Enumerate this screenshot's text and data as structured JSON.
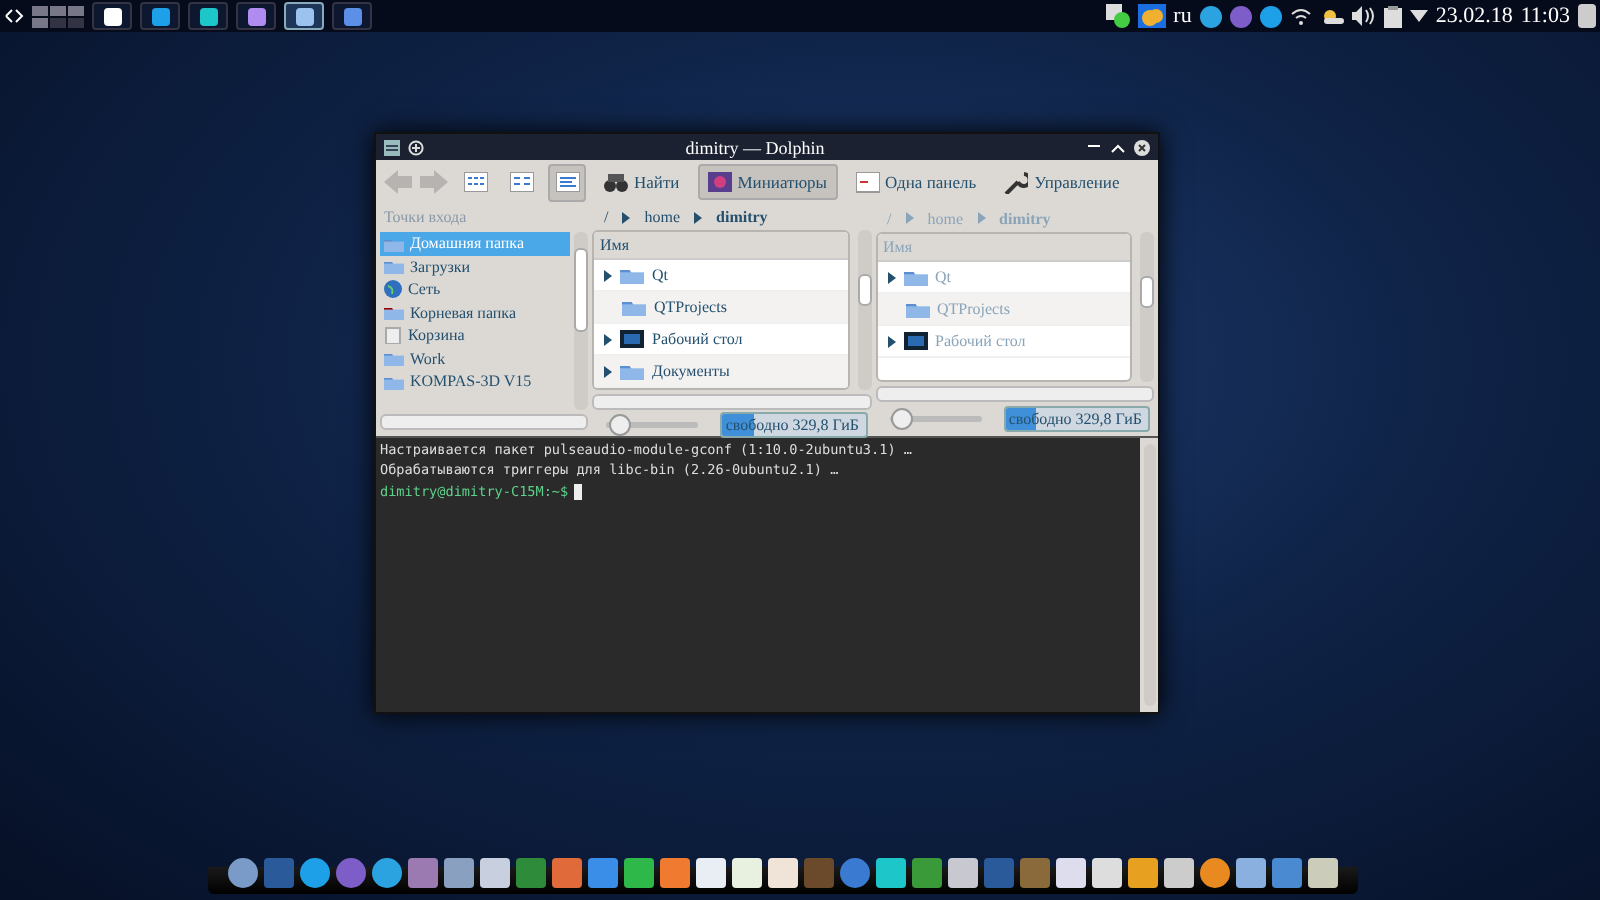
{
  "top_panel": {
    "language": "ru",
    "date": "23.02.18",
    "time": "11:03",
    "tasks": [
      {
        "selected": false
      },
      {
        "selected": false
      },
      {
        "selected": false
      },
      {
        "selected": false
      },
      {
        "selected": true
      },
      {
        "selected": false
      }
    ]
  },
  "dolphin": {
    "title": "dimitry — Dolphin",
    "view_modes": [
      {
        "selected": false
      },
      {
        "selected": false
      },
      {
        "selected": true
      }
    ],
    "toolbar": [
      {
        "label": "Найти",
        "selected": false
      },
      {
        "label": "Миниатюры",
        "selected": true
      },
      {
        "label": "Одна панель",
        "selected": false
      },
      {
        "label": "Управление",
        "selected": false
      }
    ],
    "places": {
      "heading": "Точки входа",
      "items": [
        {
          "label": "Домашняя папка",
          "selected": true
        },
        {
          "label": "Загрузки",
          "selected": false
        },
        {
          "label": "Сеть",
          "selected": false
        },
        {
          "label": "Корневая папка",
          "selected": false
        },
        {
          "label": "Корзина",
          "selected": false
        },
        {
          "label": "Work",
          "selected": false
        },
        {
          "label": "KOMPAS-3D V15",
          "selected": false
        }
      ]
    },
    "panes": [
      {
        "active": true,
        "breadcrumb": [
          "/",
          "home",
          "dimitry"
        ],
        "column": "Имя",
        "items": [
          {
            "label": "Qt",
            "expandable": true
          },
          {
            "label": "QTProjects",
            "expandable": false
          },
          {
            "label": "Рабочий стол",
            "expandable": true
          },
          {
            "label": "Документы",
            "expandable": true
          }
        ],
        "zoom": {
          "level": 0.15
        },
        "free_space": {
          "text": "свободно 329,8 ГиБ",
          "level": 0.22
        }
      },
      {
        "active": false,
        "breadcrumb": [
          "/",
          "home",
          "dimitry"
        ],
        "column": "Имя",
        "items": [
          {
            "label": "Qt",
            "expandable": true
          },
          {
            "label": "QTProjects",
            "expandable": false
          },
          {
            "label": "Рабочий стол",
            "expandable": true
          }
        ],
        "zoom": {
          "level": 0.15
        },
        "free_space": {
          "text": "свободно 329,8 ГиБ",
          "level": 0.22
        }
      }
    ]
  },
  "terminal": {
    "lines": [
      {
        "kind": "output",
        "text": "Настраивается пакет pulseaudio-module-gconf (1:10.0-2ubuntu3.1) …"
      },
      {
        "kind": "output",
        "text": "Обрабатываются триггеры для libc-bin (2.26-0ubuntu2.1) …"
      },
      {
        "kind": "prompt",
        "text": "dimitry@dimitry-C15M:~$"
      }
    ]
  }
}
